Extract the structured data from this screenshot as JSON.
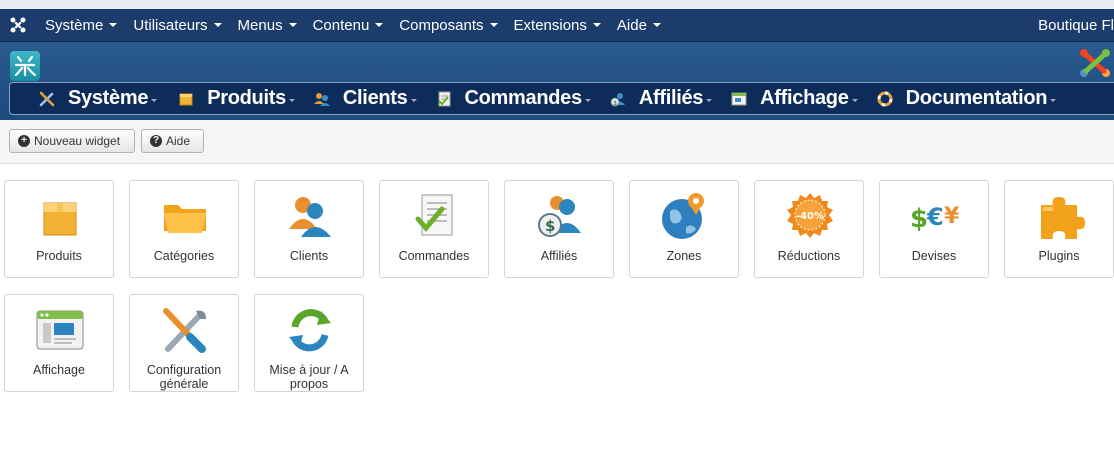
{
  "admin_menu": {
    "items": [
      {
        "label": "Système"
      },
      {
        "label": "Utilisateurs"
      },
      {
        "label": "Menus"
      },
      {
        "label": "Contenu"
      },
      {
        "label": "Composants"
      },
      {
        "label": "Extensions"
      },
      {
        "label": "Aide"
      }
    ],
    "site_name": "Boutique Fl"
  },
  "hikashop_menu": {
    "items": [
      {
        "label": "Système",
        "icon": "tools-icon"
      },
      {
        "label": "Produits",
        "icon": "box-icon"
      },
      {
        "label": "Clients",
        "icon": "users-icon"
      },
      {
        "label": "Commandes",
        "icon": "document-check-icon"
      },
      {
        "label": "Affiliés",
        "icon": "affiliates-icon"
      },
      {
        "label": "Affichage",
        "icon": "display-icon"
      },
      {
        "label": "Documentation",
        "icon": "lifebuoy-icon"
      }
    ]
  },
  "toolbar": {
    "new_widget_label": "Nouveau widget",
    "help_label": "Aide"
  },
  "dashboard": {
    "tiles": [
      {
        "label": "Produits",
        "icon": "product-box-icon"
      },
      {
        "label": "Catégories",
        "icon": "folder-icon"
      },
      {
        "label": "Clients",
        "icon": "customers-icon"
      },
      {
        "label": "Commandes",
        "icon": "orders-icon"
      },
      {
        "label": "Affiliés",
        "icon": "affiliates-icon"
      },
      {
        "label": "Zones",
        "icon": "globe-pin-icon"
      },
      {
        "label": "Réductions",
        "icon": "discount-badge-icon"
      },
      {
        "label": "Devises",
        "icon": "currencies-icon"
      },
      {
        "label": "Plugins",
        "icon": "puzzle-icon"
      },
      {
        "label": "Affichage",
        "icon": "display-window-icon"
      },
      {
        "label": "Configuration générale",
        "icon": "tools-icon"
      },
      {
        "label": "Mise à jour / A propos",
        "icon": "refresh-icon"
      }
    ],
    "discount_badge_text": "-40%",
    "currency_symbols": "$€¥"
  },
  "colors": {
    "admin_bar": "#1c3d6b",
    "header_band": "#1e4a7c",
    "hk_menu": "#0e2c59"
  }
}
